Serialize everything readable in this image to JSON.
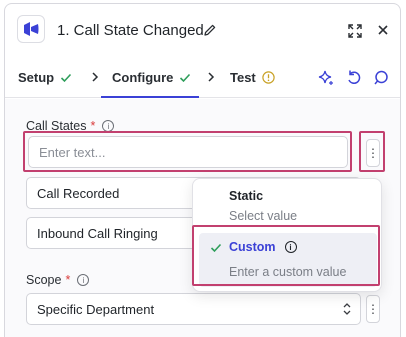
{
  "header": {
    "title": "1. Call State Changed",
    "brand_color": "#3b41d6"
  },
  "tabs": [
    {
      "label": "Setup",
      "status": "check",
      "status_color": "#2e9e5b"
    },
    {
      "label": "Configure",
      "status": "check",
      "status_color": "#2e9e5b"
    },
    {
      "label": "Test",
      "status": "warning",
      "status_color": "#c9a227"
    }
  ],
  "form": {
    "call_states": {
      "label": "Call States",
      "required_mark": "*",
      "info_glyph": "i",
      "placeholder": "Enter text...",
      "items": [
        {
          "value": "Call Recorded"
        },
        {
          "value": "Inbound Call Ringing"
        }
      ]
    },
    "scope": {
      "label": "Scope",
      "required_mark": "*",
      "info_glyph": "i",
      "value": "Specific Department"
    }
  },
  "dropdown": {
    "options": [
      {
        "title": "Static",
        "subtitle": "Select value",
        "selected": false
      },
      {
        "title": "Custom",
        "subtitle": "Enter a custom value",
        "selected": true,
        "info_glyph": "i"
      }
    ]
  },
  "highlight_color": "#c2406f"
}
